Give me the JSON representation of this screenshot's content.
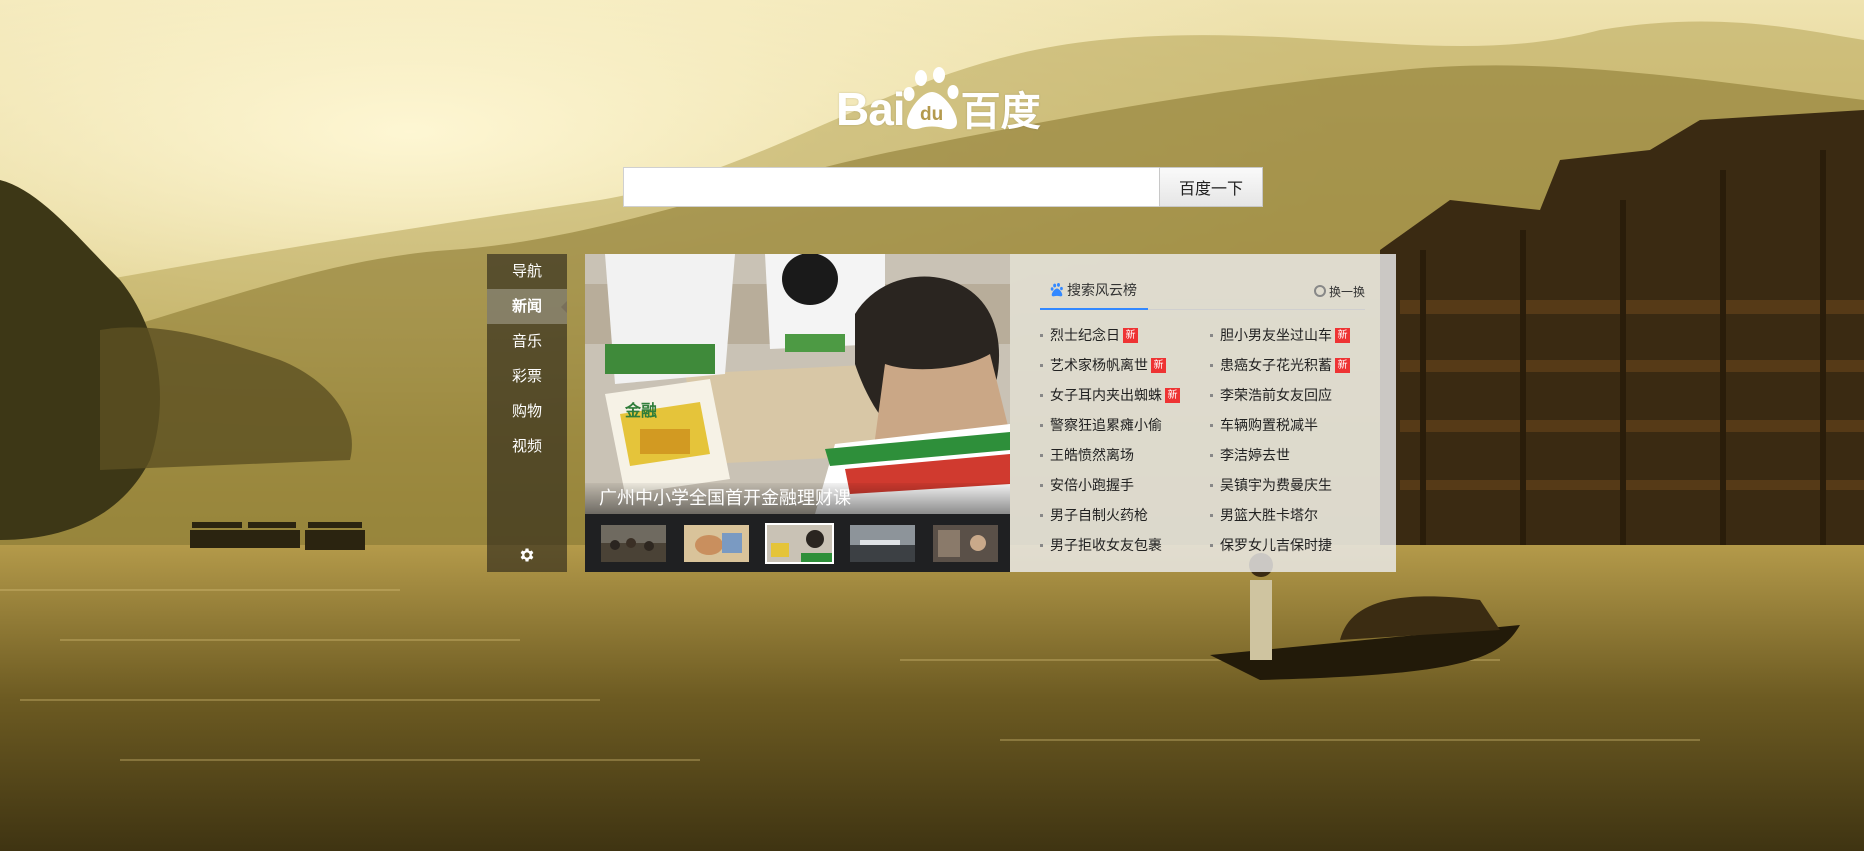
{
  "logo": {
    "text_left": "Bai",
    "text_paw": "du",
    "text_right": "百度"
  },
  "search": {
    "value": "",
    "placeholder": "",
    "button_label": "百度一下"
  },
  "sidenav": {
    "items": [
      {
        "label": "导航",
        "active": false
      },
      {
        "label": "新闻",
        "active": true
      },
      {
        "label": "音乐",
        "active": false
      },
      {
        "label": "彩票",
        "active": false
      },
      {
        "label": "购物",
        "active": false
      },
      {
        "label": "视频",
        "active": false
      }
    ],
    "settings_icon": "gear-icon"
  },
  "news": {
    "caption": "广州中小学全国首开金融理财课",
    "book_text": "金融",
    "thumbnails": [
      {
        "name": "street-crowd",
        "active": false
      },
      {
        "name": "hands-craft",
        "active": false
      },
      {
        "name": "classroom",
        "active": true
      },
      {
        "name": "harbor-sky",
        "active": false
      },
      {
        "name": "people-scene",
        "active": false
      }
    ]
  },
  "hotlist": {
    "tab_label": "搜索风云榜",
    "refresh_label": "换一换",
    "new_badge": "新",
    "left": [
      {
        "text": "烈士纪念日",
        "new": true
      },
      {
        "text": "艺术家杨帆离世",
        "new": true
      },
      {
        "text": "女子耳内夹出蜘蛛",
        "new": true
      },
      {
        "text": "警察狂追累瘫小偷",
        "new": false
      },
      {
        "text": "王皓愤然离场",
        "new": false
      },
      {
        "text": "安倍小跑握手",
        "new": false
      },
      {
        "text": "男子自制火药枪",
        "new": false
      },
      {
        "text": "男子拒收女友包裹",
        "new": false
      }
    ],
    "right": [
      {
        "text": "胆小男友坐过山车",
        "new": true
      },
      {
        "text": "患癌女子花光积蓄",
        "new": true
      },
      {
        "text": "李荣浩前女友回应",
        "new": false
      },
      {
        "text": "车辆购置税减半",
        "new": false
      },
      {
        "text": "李洁婷去世",
        "new": false
      },
      {
        "text": "吴镇宇为费曼庆生",
        "new": false
      },
      {
        "text": "男篮大胜卡塔尔",
        "new": false
      },
      {
        "text": "保罗女儿吉保时捷",
        "new": false
      }
    ]
  }
}
